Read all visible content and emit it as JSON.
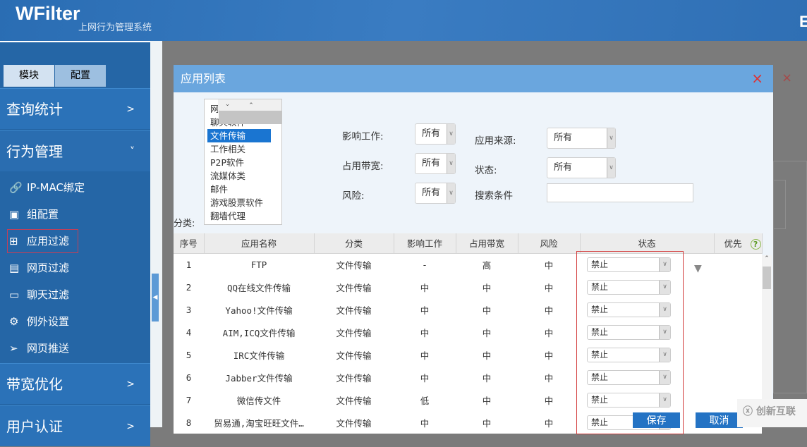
{
  "header": {
    "logo": "WFilter",
    "subtitle": "上网行为管理系统",
    "right_fragment": "E"
  },
  "sidebar": {
    "tabs": [
      "模块",
      "配置"
    ],
    "sections": [
      {
        "label": "查询统计",
        "chev": ">"
      },
      {
        "label": "行为管理",
        "chev": "˅"
      },
      {
        "label": "带宽优化",
        "chev": ">"
      },
      {
        "label": "用户认证",
        "chev": ">"
      }
    ],
    "items": [
      {
        "label": "IP-MAC绑定",
        "icon": "link-icon"
      },
      {
        "label": "组配置",
        "icon": "group-card-icon"
      },
      {
        "label": "应用过滤",
        "icon": "apps-grid-icon"
      },
      {
        "label": "网页过滤",
        "icon": "webpage-icon"
      },
      {
        "label": "聊天过滤",
        "icon": "chat-icon"
      },
      {
        "label": "例外设置",
        "icon": "gear-icon"
      },
      {
        "label": "网页推送",
        "icon": "send-icon"
      }
    ]
  },
  "dialog": {
    "title": "应用列表",
    "close": "×",
    "category_label": "分类:",
    "categories": [
      "网页浏览",
      "聊天软件",
      "文件传输",
      "工作相关",
      "P2P软件",
      "流媒体类",
      "邮件",
      "游戏股票软件",
      "翻墙代理"
    ],
    "selected_category": "文件传输",
    "filters": {
      "impact_label": "影响工作:",
      "impact": "所有",
      "bandwidth_label": "占用带宽:",
      "bandwidth": "所有",
      "risk_label": "风险:",
      "risk": "所有",
      "source_label": "应用来源:",
      "source": "所有",
      "status_label": "状态:",
      "status": "所有",
      "search_label": "搜索条件",
      "search_value": ""
    },
    "columns": [
      "序号",
      "应用名称",
      "分类",
      "影响工作",
      "占用带宽",
      "风险",
      "状态",
      "优先"
    ],
    "rows": [
      [
        "1",
        "FTP",
        "文件传输",
        "-",
        "高",
        "中",
        "禁止"
      ],
      [
        "2",
        "QQ在线文件传输",
        "文件传输",
        "中",
        "中",
        "中",
        "禁止"
      ],
      [
        "3",
        "Yahoo!文件传输",
        "文件传输",
        "中",
        "中",
        "中",
        "禁止"
      ],
      [
        "4",
        "AIM,ICQ文件传输",
        "文件传输",
        "中",
        "中",
        "中",
        "禁止"
      ],
      [
        "5",
        "IRC文件传输",
        "文件传输",
        "中",
        "中",
        "中",
        "禁止"
      ],
      [
        "6",
        "Jabber文件传输",
        "文件传输",
        "中",
        "中",
        "中",
        "禁止"
      ],
      [
        "7",
        "微信传文件",
        "文件传输",
        "低",
        "中",
        "中",
        "禁止"
      ],
      [
        "8",
        "贸易通,淘宝旺旺文件…",
        "文件传输",
        "中",
        "中",
        "中",
        "禁止"
      ]
    ],
    "help": "?",
    "save": "保存",
    "cancel": "取消"
  },
  "watermark": "创新互联",
  "background_close": "×"
}
